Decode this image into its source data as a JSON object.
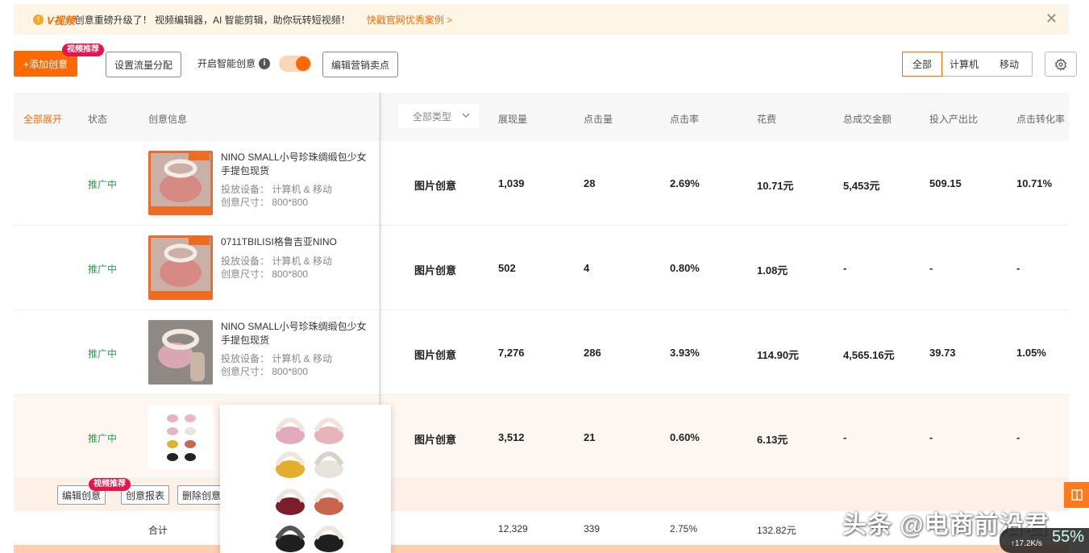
{
  "notice": {
    "brand": "V视频",
    "message": "创意重磅升级了！ 视频编辑器，AI 智能剪辑，助你玩转短视频！",
    "link": "快戳官网优秀案例 >",
    "close": "✕"
  },
  "toolbar": {
    "add_creative": "+添加创意",
    "hot_badge": "视频推荐",
    "traffic_split": "设置流量分配",
    "smart_creative": "开启智能创意",
    "smart_enabled": true,
    "edit_selling_points": "编辑营销卖点",
    "device_tabs": [
      "全部",
      "计算机",
      "移动"
    ],
    "device_active": "全部"
  },
  "table": {
    "headers": {
      "expand_all": "全部展开",
      "status": "状态",
      "info": "创意信息",
      "type_filter": "全部类型",
      "impressions": "展现量",
      "clicks": "点击量",
      "ctr": "点击率",
      "cost": "花费",
      "gmv": "总成交金额",
      "roi": "投入产出比",
      "cvr": "点击转化率"
    },
    "rows": [
      {
        "status": "推广中",
        "title": "NINO SMALL小号珍珠绸缎包少女手提包现货",
        "device": "投放设备： 计算机 & 移动",
        "size": "创意尺寸： 800*800",
        "type": "图片创意",
        "impressions": "1,039",
        "clicks": "28",
        "ctr": "2.69%",
        "cost": "10.71元",
        "gmv": "5,453元",
        "roi": "509.15",
        "cvr": "10.71%"
      },
      {
        "status": "推广中",
        "title": "0711TBILISI格鲁吉亚NINO",
        "device": "投放设备： 计算机 & 移动",
        "size": "创意尺寸： 800*800",
        "type": "图片创意",
        "impressions": "502",
        "clicks": "4",
        "ctr": "0.80%",
        "cost": "1.08元",
        "gmv": "-",
        "roi": "-",
        "cvr": "-"
      },
      {
        "status": "推广中",
        "title": "NINO SMALL小号珍珠绸缎包少女手提包现货",
        "device": "投放设备： 计算机 & 移动",
        "size": "创意尺寸： 800*800",
        "type": "图片创意",
        "impressions": "7,276",
        "clicks": "286",
        "ctr": "3.93%",
        "cost": "114.90元",
        "gmv": "4,565.16元",
        "roi": "39.73",
        "cvr": "1.05%"
      },
      {
        "status": "推广中",
        "type": "图片创意",
        "impressions": "3,512",
        "clicks": "21",
        "ctr": "0.60%",
        "cost": "6.13元",
        "gmv": "-",
        "roi": "-",
        "cvr": "-"
      }
    ],
    "row_actions": {
      "edit": "编辑创意",
      "hot_badge": "视频推荐",
      "report": "创意报表",
      "delete": "删除创意"
    },
    "total": {
      "label": "合计",
      "impressions": "12,329",
      "clicks": "339",
      "ctr": "2.75%",
      "cost": "132.82元"
    }
  },
  "overlay": {
    "watermark": "头条 @电商前沿君",
    "speed_pct": "55%",
    "speed_rate": "↑17.2K/s"
  },
  "colors": {
    "accent": "#ff6a00",
    "status_green": "#2b9e4a",
    "hot_badge": "#e8144b"
  }
}
